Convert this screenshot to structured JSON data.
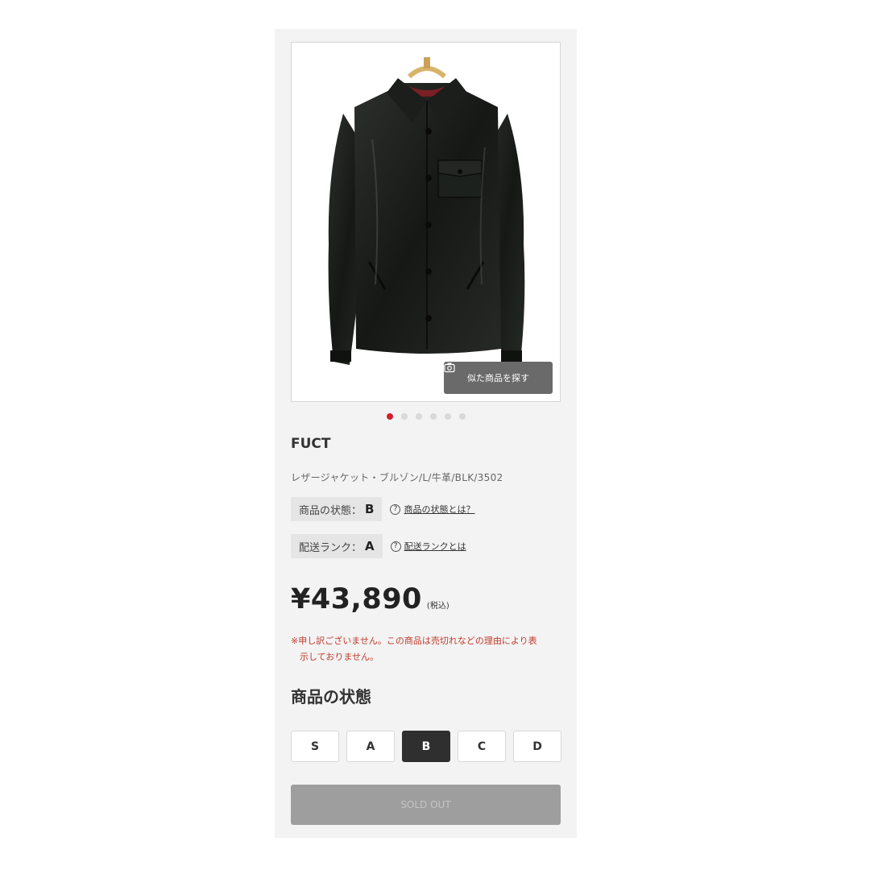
{
  "product": {
    "brand": "FUCT",
    "name": "レザージャケット・ブルゾン/L/牛革/BLK/3502",
    "image_alt": "",
    "similar_button": "似た商品を探す",
    "carousel": {
      "count": 6,
      "active_index": 0
    }
  },
  "condition_tag": {
    "label": "商品の状態：",
    "value": "B",
    "help": "商品の状態とは？"
  },
  "shipping_tag": {
    "label": "配送ランク：",
    "value": "A",
    "help": "配送ランクとは"
  },
  "price": {
    "amount": "¥43,890",
    "tax_note": "(税込)"
  },
  "notice": {
    "line1": "※申し訳ございません。この商品は売切れなどの理由により表",
    "line2": "示しておりません。"
  },
  "condition_section": {
    "title": "商品の状態",
    "grades": [
      "S",
      "A",
      "B",
      "C",
      "D"
    ],
    "selected": "B"
  },
  "action": {
    "sold_out_label": "SOLD OUT"
  },
  "colors": {
    "accent_dot": "#d0202c",
    "notice_text": "#c0392b",
    "selected_grade": "#2f2f2f"
  }
}
